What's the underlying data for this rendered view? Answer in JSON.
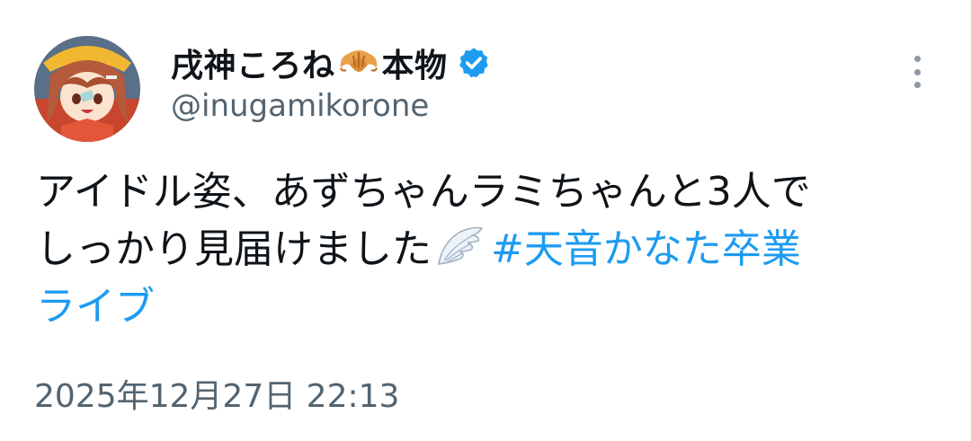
{
  "author": {
    "display_name_part1": "戌神ころね",
    "display_name_part2": "本物",
    "name_emoji": "croissant-icon",
    "handle": "@inugamikorone",
    "verified": true,
    "verified_color": "#1d9bf0"
  },
  "tweet": {
    "line1": "アイドル姿、あずちゃんラミちゃんと3人で",
    "line2_text": "しっかり見届けました",
    "inline_emoji": "wing-icon",
    "hashtag_part1": "#天音かなた卒業",
    "hashtag_part2": "ライブ",
    "hashtag_color": "#1d9bf0"
  },
  "timestamp": "2025年12月27日 22:13",
  "colors": {
    "text": "#0f1419",
    "secondary": "#536471",
    "accent": "#1d9bf0"
  }
}
